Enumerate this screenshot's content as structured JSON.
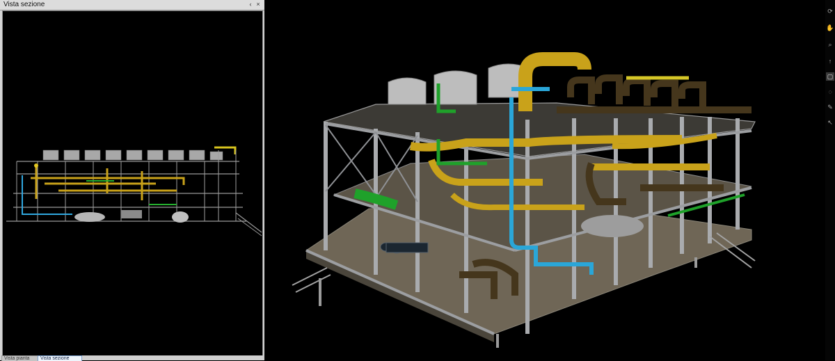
{
  "panel": {
    "title": "Vista sezione",
    "pin_glyph": "‹",
    "close_glyph": "×"
  },
  "tabs": [
    {
      "label": "Vista pianta",
      "active": false
    },
    {
      "label": "Vista sezione",
      "active": true
    }
  ],
  "toolbar": {
    "tools": [
      "rotate-icon",
      "pan-hand-icon",
      "zoom-icon",
      "arrow-up-icon",
      "select-icon",
      "orbit-icon",
      "pen-icon",
      "cursor-icon"
    ],
    "active_tool": "select-icon"
  },
  "colors": {
    "background": "#000000",
    "steel": "#8d9094",
    "pipe_yellow": "#c9a21a",
    "pipe_green": "#1f9e2a",
    "pipe_cyan": "#2aa6d8",
    "pipe_brown": "#4b3a1d",
    "vessel": "#b9b9b9",
    "deck": "#7d7462"
  }
}
